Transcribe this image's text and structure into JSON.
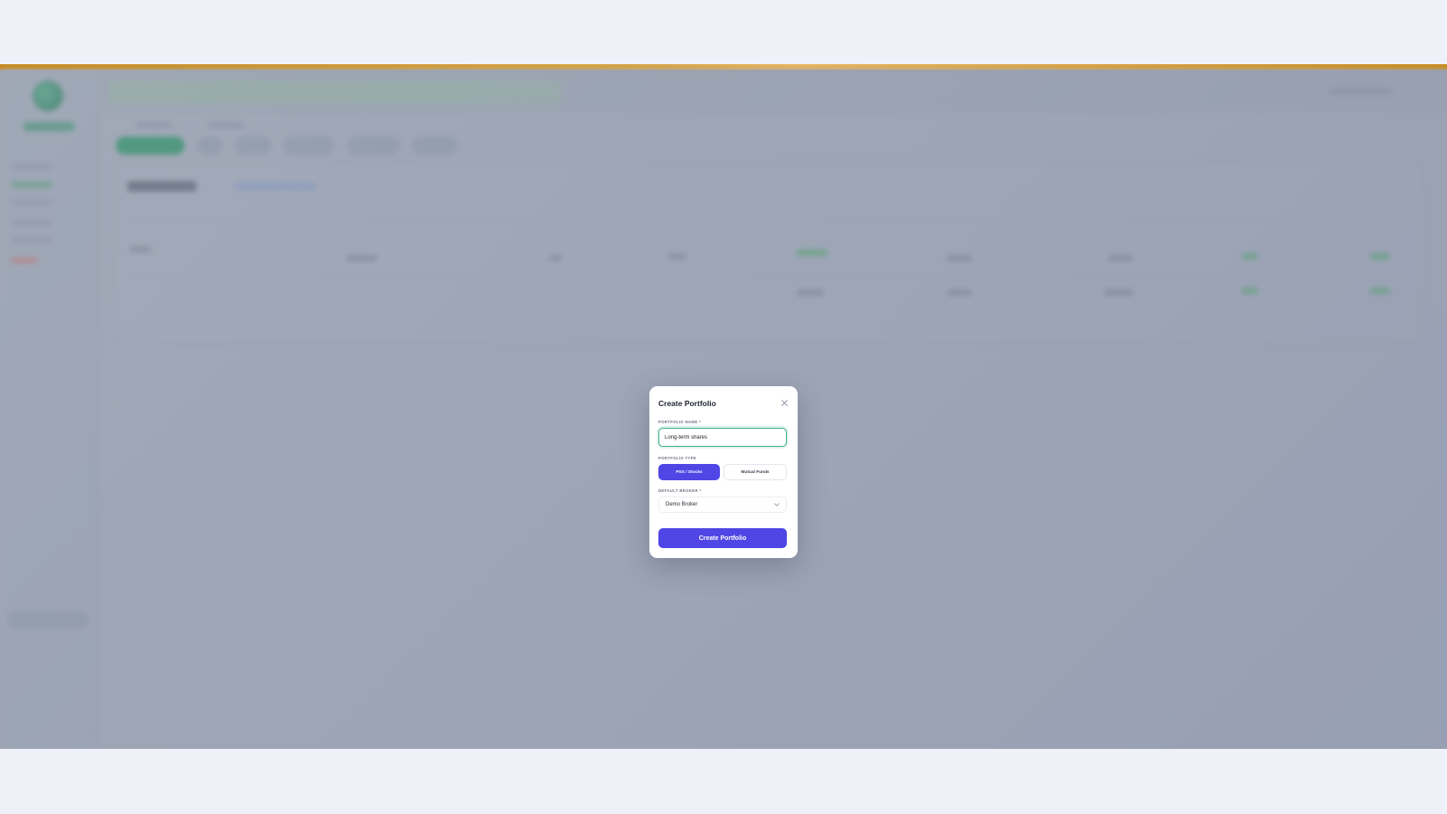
{
  "modal": {
    "title": "Create Portfolio",
    "portfolio_name_label": "PORTFOLIO NAME *",
    "portfolio_name_value": "Long-term shares",
    "portfolio_type_label": "PORTFOLIO TYPE",
    "portfolio_type_options": [
      "PSX / Stocks",
      "Mutual Funds"
    ],
    "portfolio_type_selected": "PSX / Stocks",
    "default_broker_label": "DEFAULT BROKER *",
    "default_broker_value": "Demo Broker",
    "submit_label": "Create Portfolio"
  },
  "colors": {
    "primary": "#4f46e5",
    "focus_border": "#3fae89",
    "accent_bar": "#d9a441",
    "overlay": "#a9b0bd"
  },
  "icons": {
    "close": "close-icon",
    "select_arrow": "chevron-down-icon"
  }
}
